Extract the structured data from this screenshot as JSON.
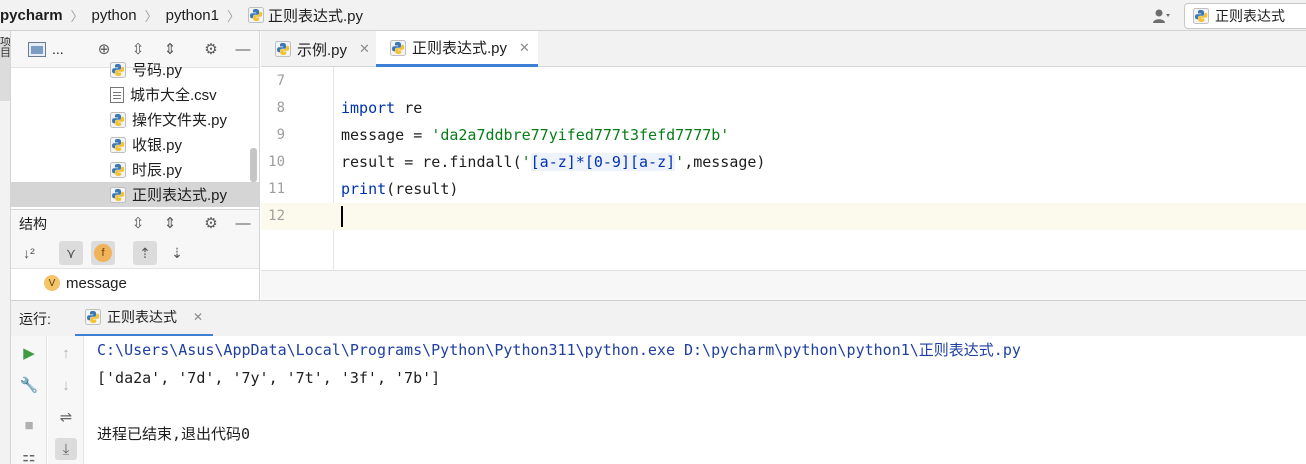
{
  "breadcrumb": [
    "pycharm",
    "python",
    "python1",
    "正则表达式.py"
  ],
  "run_config": {
    "label": "正则表达式"
  },
  "left_strip_label": "项目",
  "project_panel": {
    "title": "...",
    "files": [
      {
        "name": "号码.py",
        "type": "py"
      },
      {
        "name": "城市大全.csv",
        "type": "csv"
      },
      {
        "name": "操作文件夹.py",
        "type": "py"
      },
      {
        "name": "收银.py",
        "type": "py"
      },
      {
        "name": "时辰.py",
        "type": "py"
      },
      {
        "name": "正则表达式.py",
        "type": "py",
        "selected": true
      }
    ]
  },
  "structure": {
    "title": "结构",
    "badge_f": "f",
    "items": [
      {
        "badge": "V",
        "name": "message"
      }
    ]
  },
  "editor_tabs": [
    {
      "label": "示例.py",
      "active": false
    },
    {
      "label": "正则表达式.py",
      "active": true
    }
  ],
  "editor": {
    "lines": [
      {
        "num": "7"
      },
      {
        "num": "8",
        "text": "import re"
      },
      {
        "num": "9",
        "text": "message = 'da2a7ddbre77yifed777t3fefd7777b'"
      },
      {
        "num": "10",
        "text": "result = re.findall('[a-z]*[0-9][a-z]',message)"
      },
      {
        "num": "11",
        "text": "print(result)"
      },
      {
        "num": "12",
        "current": true
      }
    ]
  },
  "run_panel": {
    "title": "运行:",
    "tab_label": "正则表达式",
    "console": [
      "C:\\Users\\Asus\\AppData\\Local\\Programs\\Python\\Python311\\python.exe D:\\pycharm\\python\\python1\\正则表达式.py",
      "['da2a', '7d', '7y', '7t', '3f', '7b']",
      "",
      "进程已结束,退出代码0"
    ]
  },
  "colors": {
    "accent": "#3d7fd6",
    "keyword": "#0033b3",
    "string": "#067d17",
    "path": "#1f40a0"
  }
}
